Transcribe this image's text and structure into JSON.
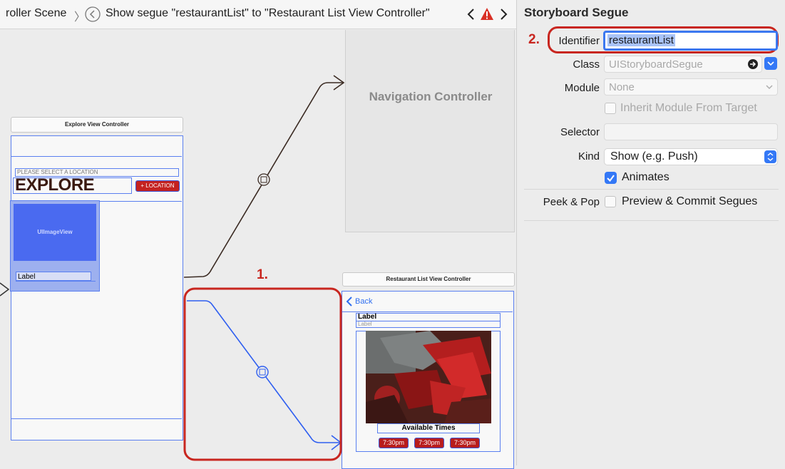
{
  "breadcrumb": {
    "scene": "roller Scene",
    "segue_title": "Show segue \"restaurantList\" to \"Restaurant List View Controller\""
  },
  "canvas": {
    "explore_vc_title": "Explore View Controller",
    "location_placeholder": "PLEASE SELECT A LOCATION",
    "explore_heading": "EXPLORE",
    "location_button": "+ LOCATION",
    "image_view_label": "UIImageView",
    "cell_label": "Label",
    "nav_controller_label": "Navigation Controller",
    "restaurant_vc_title": "Restaurant List View Controller",
    "back_label": "Back",
    "restaurant_label": "Label",
    "restaurant_sublabel": "Label",
    "available_times": "Available Times",
    "times": [
      "7:30pm",
      "7:30pm",
      "7:30pm"
    ],
    "step1": "1.",
    "step2": "2."
  },
  "inspector": {
    "title": "Storyboard Segue",
    "identifier_label": "Identifier",
    "identifier_value": "restaurantList",
    "class_label": "Class",
    "class_value": "UIStoryboardSegue",
    "module_label": "Module",
    "module_value": "None",
    "inherit_label": "Inherit Module From Target",
    "selector_label": "Selector",
    "selector_value": "",
    "kind_label": "Kind",
    "kind_value": "Show (e.g. Push)",
    "animates_label": "Animates",
    "animates_checked": true,
    "peek_label": "Peek & Pop",
    "preview_label": "Preview & Commit Segues",
    "preview_checked": false
  },
  "colors": {
    "accent": "#3478f6",
    "highlight_red": "#c8261f",
    "selection_blue": "#5a7ff0"
  }
}
